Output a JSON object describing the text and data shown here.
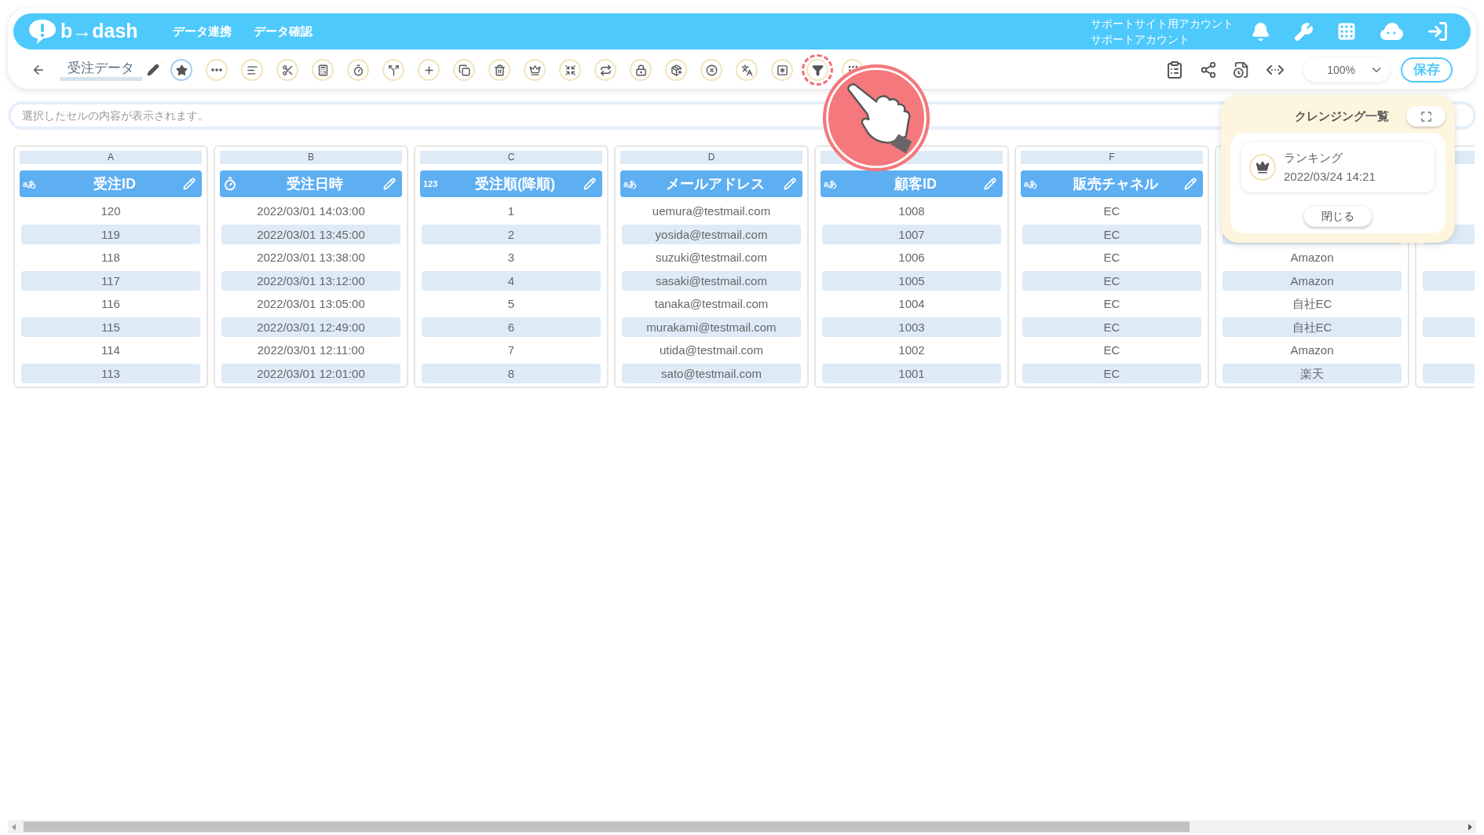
{
  "header": {
    "brand": "b→dash",
    "nav": [
      "データ連携",
      "データ確認"
    ],
    "account": [
      "サポートサイト用アカウント",
      "サポートアカウント"
    ]
  },
  "toolbar": {
    "title": "受注データ",
    "tools": [
      {
        "kind": "star",
        "active": true,
        "highlighted": false
      },
      {
        "kind": "dots",
        "active": false,
        "highlighted": false
      },
      {
        "kind": "lines",
        "active": false,
        "highlighted": false
      },
      {
        "kind": "scissors",
        "active": false,
        "highlighted": false
      },
      {
        "kind": "calc",
        "active": false,
        "highlighted": false
      },
      {
        "kind": "timer",
        "active": false,
        "highlighted": false
      },
      {
        "kind": "fork",
        "active": false,
        "highlighted": false
      },
      {
        "kind": "plus",
        "active": false,
        "highlighted": false
      },
      {
        "kind": "copy",
        "active": false,
        "highlighted": false
      },
      {
        "kind": "trash",
        "active": false,
        "highlighted": false
      },
      {
        "kind": "crown",
        "active": false,
        "highlighted": false
      },
      {
        "kind": "shrink",
        "active": false,
        "highlighted": false
      },
      {
        "kind": "repeat",
        "active": false,
        "highlighted": false
      },
      {
        "kind": "lock",
        "active": false,
        "highlighted": false
      },
      {
        "kind": "box",
        "active": false,
        "highlighted": false
      },
      {
        "kind": "xcircle",
        "active": false,
        "highlighted": false
      },
      {
        "kind": "translate",
        "active": false,
        "highlighted": false
      },
      {
        "kind": "zero",
        "active": false,
        "highlighted": false
      },
      {
        "kind": "filter",
        "active": false,
        "highlighted": true
      },
      {
        "kind": "grid",
        "active": false,
        "highlighted": false
      }
    ],
    "zoom": "100%",
    "save": "保存"
  },
  "formula_bar": {
    "placeholder": "選択したセルの内容が表示されます。"
  },
  "table": {
    "columns": [
      {
        "letter": "A",
        "header": "受注ID",
        "kind": "text",
        "type_label": "aあ",
        "cells": [
          "120",
          "119",
          "118",
          "117",
          "116",
          "115",
          "114",
          "113"
        ]
      },
      {
        "letter": "B",
        "header": "受注日時",
        "kind": "datetime",
        "cells": [
          "2022/03/01 14:03:00",
          "2022/03/01 13:45:00",
          "2022/03/01 13:38:00",
          "2022/03/01 13:12:00",
          "2022/03/01 13:05:00",
          "2022/03/01 12:49:00",
          "2022/03/01 12:11:00",
          "2022/03/01 12:01:00"
        ]
      },
      {
        "letter": "C",
        "header": "受注順(降順)",
        "kind": "number",
        "type_label": "123",
        "cells": [
          "1",
          "2",
          "3",
          "4",
          "5",
          "6",
          "7",
          "8"
        ]
      },
      {
        "letter": "D",
        "header": "メールアドレス",
        "kind": "text",
        "type_label": "aあ",
        "cells": [
          "uemura@testmail.com",
          "yosida@testmail.com",
          "suzuki@testmail.com",
          "sasaki@testmail.com",
          "tanaka@testmail.com",
          "murakami@testmail.com",
          "utida@testmail.com",
          "sato@testmail.com"
        ]
      },
      {
        "header": "顧客ID",
        "kind": "text",
        "type_label": "aあ",
        "cells": [
          "1008",
          "1007",
          "1006",
          "1005",
          "1004",
          "1003",
          "1002",
          "1001"
        ]
      },
      {
        "letter": "F",
        "header": "販売チャネル",
        "kind": "text",
        "type_label": "aあ",
        "cells": [
          "EC",
          "EC",
          "EC",
          "EC",
          "EC",
          "EC",
          "EC",
          "EC"
        ]
      },
      {
        "cells": [
          "Amazon",
          "Amazon",
          "自社EC",
          "自社EC",
          "Amazon",
          "楽天"
        ]
      }
    ]
  },
  "cleansing_panel": {
    "title": "クレンジング一覧",
    "items": [
      {
        "name": "ランキング",
        "time": "2022/03/24 14:21"
      }
    ],
    "close": "閉じる"
  }
}
